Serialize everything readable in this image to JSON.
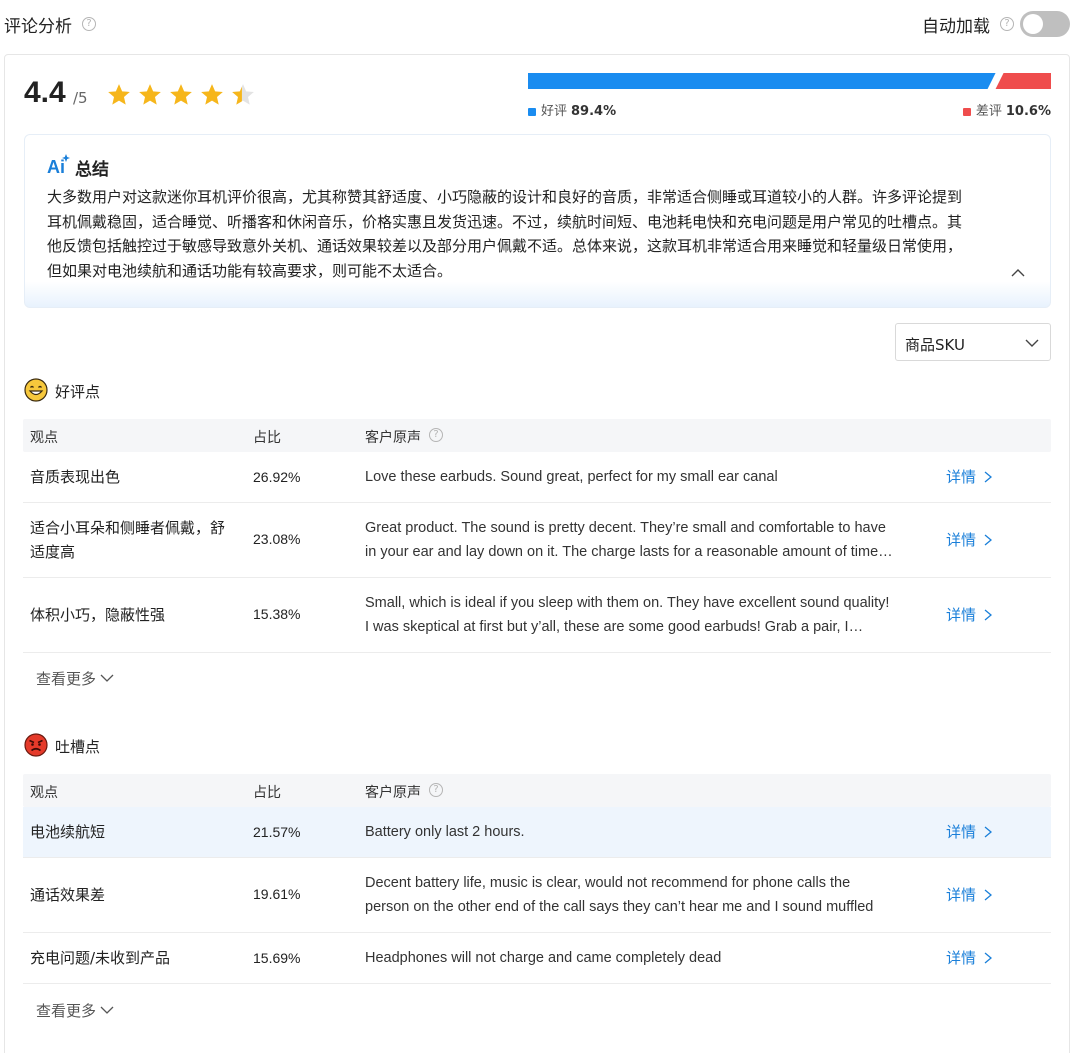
{
  "header": {
    "title": "评论分析",
    "auto_load_label": "自动加载",
    "auto_load_on": false
  },
  "rating": {
    "score": "4.4",
    "max": "/5",
    "stars_value": 4.4,
    "star_color": "#f6b61b",
    "positive_label": "好评",
    "positive_pct": "89.4%",
    "positive_value": 89.4,
    "positive_color": "#1a8cf0",
    "negative_label": "差评",
    "negative_pct": "10.6%",
    "negative_color": "#ef4d4d"
  },
  "ai_summary": {
    "title": "总结",
    "lines": [
      "大多数用户对这款迷你耳机评价很高，尤其称赞其舒适度、小巧隐蔽的设计和良好的音质，非常适合侧睡或耳道较小的人群。许多评论提到",
      "耳机佩戴稳固，适合睡觉、听播客和休闲音乐，价格实惠且发货迅速。不过，续航时间短、电池耗电快和充电问题是用户常见的吐槽点。其",
      "他反馈包括触控过于敏感导致意外关机、通话效果较差以及部分用户佩戴不适。总体来说，这款耳机非常适合用来睡觉和轻量级日常使用，",
      "但如果对电池续航和通话功能有较高要求，则可能不太适合。"
    ]
  },
  "sku_select": {
    "value": "商品SKU"
  },
  "positive_section": {
    "title": "好评点",
    "headers": [
      "观点",
      "占比",
      "客户原声"
    ],
    "rows": [
      {
        "point": [
          "音质表现出色"
        ],
        "pct": "26.92%",
        "voice": [
          "Love these earbuds. Sound great, perfect for my small ear canal"
        ],
        "link": "详情"
      },
      {
        "point": [
          "适合小耳朵和侧睡者佩戴，舒",
          "适度高"
        ],
        "pct": "23.08%",
        "voice": [
          "Great product. The sound is pretty decent. They’re small and comfortable to have",
          "in your ear and lay down on it. The charge lasts for a reasonable amount of time…"
        ],
        "link": "详情"
      },
      {
        "point": [
          "体积小巧，隐蔽性强"
        ],
        "pct": "15.38%",
        "voice": [
          "Small, which is ideal if you sleep with them on. They have excellent sound quality!",
          "I was skeptical at first but y’all, these are some good earbuds! Grab a pair, I…"
        ],
        "link": "详情"
      }
    ],
    "more": "查看更多"
  },
  "negative_section": {
    "title": "吐槽点",
    "headers": [
      "观点",
      "占比",
      "客户原声"
    ],
    "rows": [
      {
        "point": [
          "电池续航短"
        ],
        "pct": "21.57%",
        "voice": [
          "Battery only last 2 hours."
        ],
        "link": "详情"
      },
      {
        "point": [
          "通话效果差"
        ],
        "pct": "19.61%",
        "voice": [
          "Decent battery life, music is clear, would not recommend for phone calls the",
          "person on the other end of the call says they can’t hear me and I sound muffled"
        ],
        "link": "详情"
      },
      {
        "point": [
          "充电问题/未收到产品"
        ],
        "pct": "15.69%",
        "voice": [
          "Headphones will not charge and came completely dead"
        ],
        "link": "详情"
      }
    ],
    "more": "查看更多"
  }
}
